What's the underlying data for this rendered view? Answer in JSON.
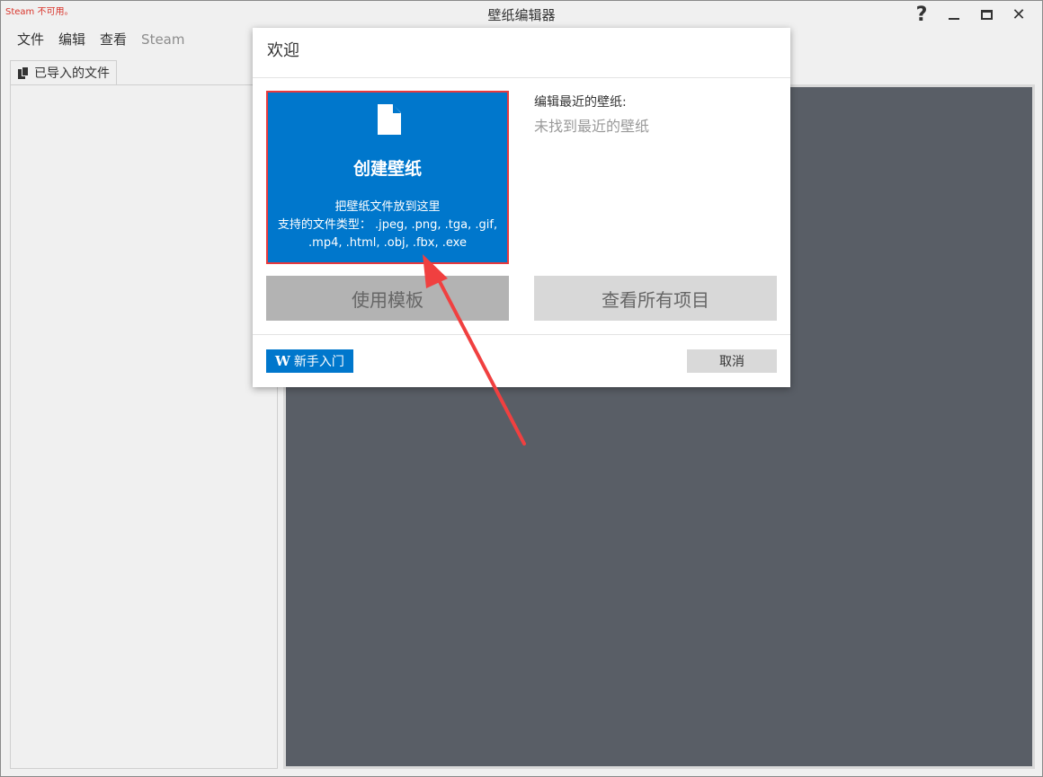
{
  "window": {
    "title": "壁纸编辑器",
    "steam_warning": "Steam 不可用。",
    "controls": {
      "help": "?",
      "close": "✕"
    }
  },
  "menu": [
    {
      "label": "文件",
      "enabled": true
    },
    {
      "label": "编辑",
      "enabled": true
    },
    {
      "label": "查看",
      "enabled": true
    },
    {
      "label": "Steam",
      "enabled": false
    }
  ],
  "left_panel": {
    "tab_label": "已导入的文件"
  },
  "dialog": {
    "title": "欢迎",
    "create_card": {
      "title": "创建壁纸",
      "line1": "把壁纸文件放到这里",
      "line2": "支持的文件类型： .jpeg, .png, .tga, .gif,",
      "line3": ".mp4, .html, .obj, .fbx, .exe"
    },
    "recent": {
      "label": "编辑最近的壁纸:",
      "empty": "未找到最近的壁纸"
    },
    "template_button": "使用模板",
    "all_projects_button": "查看所有项目",
    "wiki_button": {
      "icon": "W",
      "label": "新手入门"
    },
    "cancel_button": "取消"
  },
  "colors": {
    "accent": "#0077cc",
    "highlight": "#e8393d",
    "viewport": "#595e66"
  }
}
